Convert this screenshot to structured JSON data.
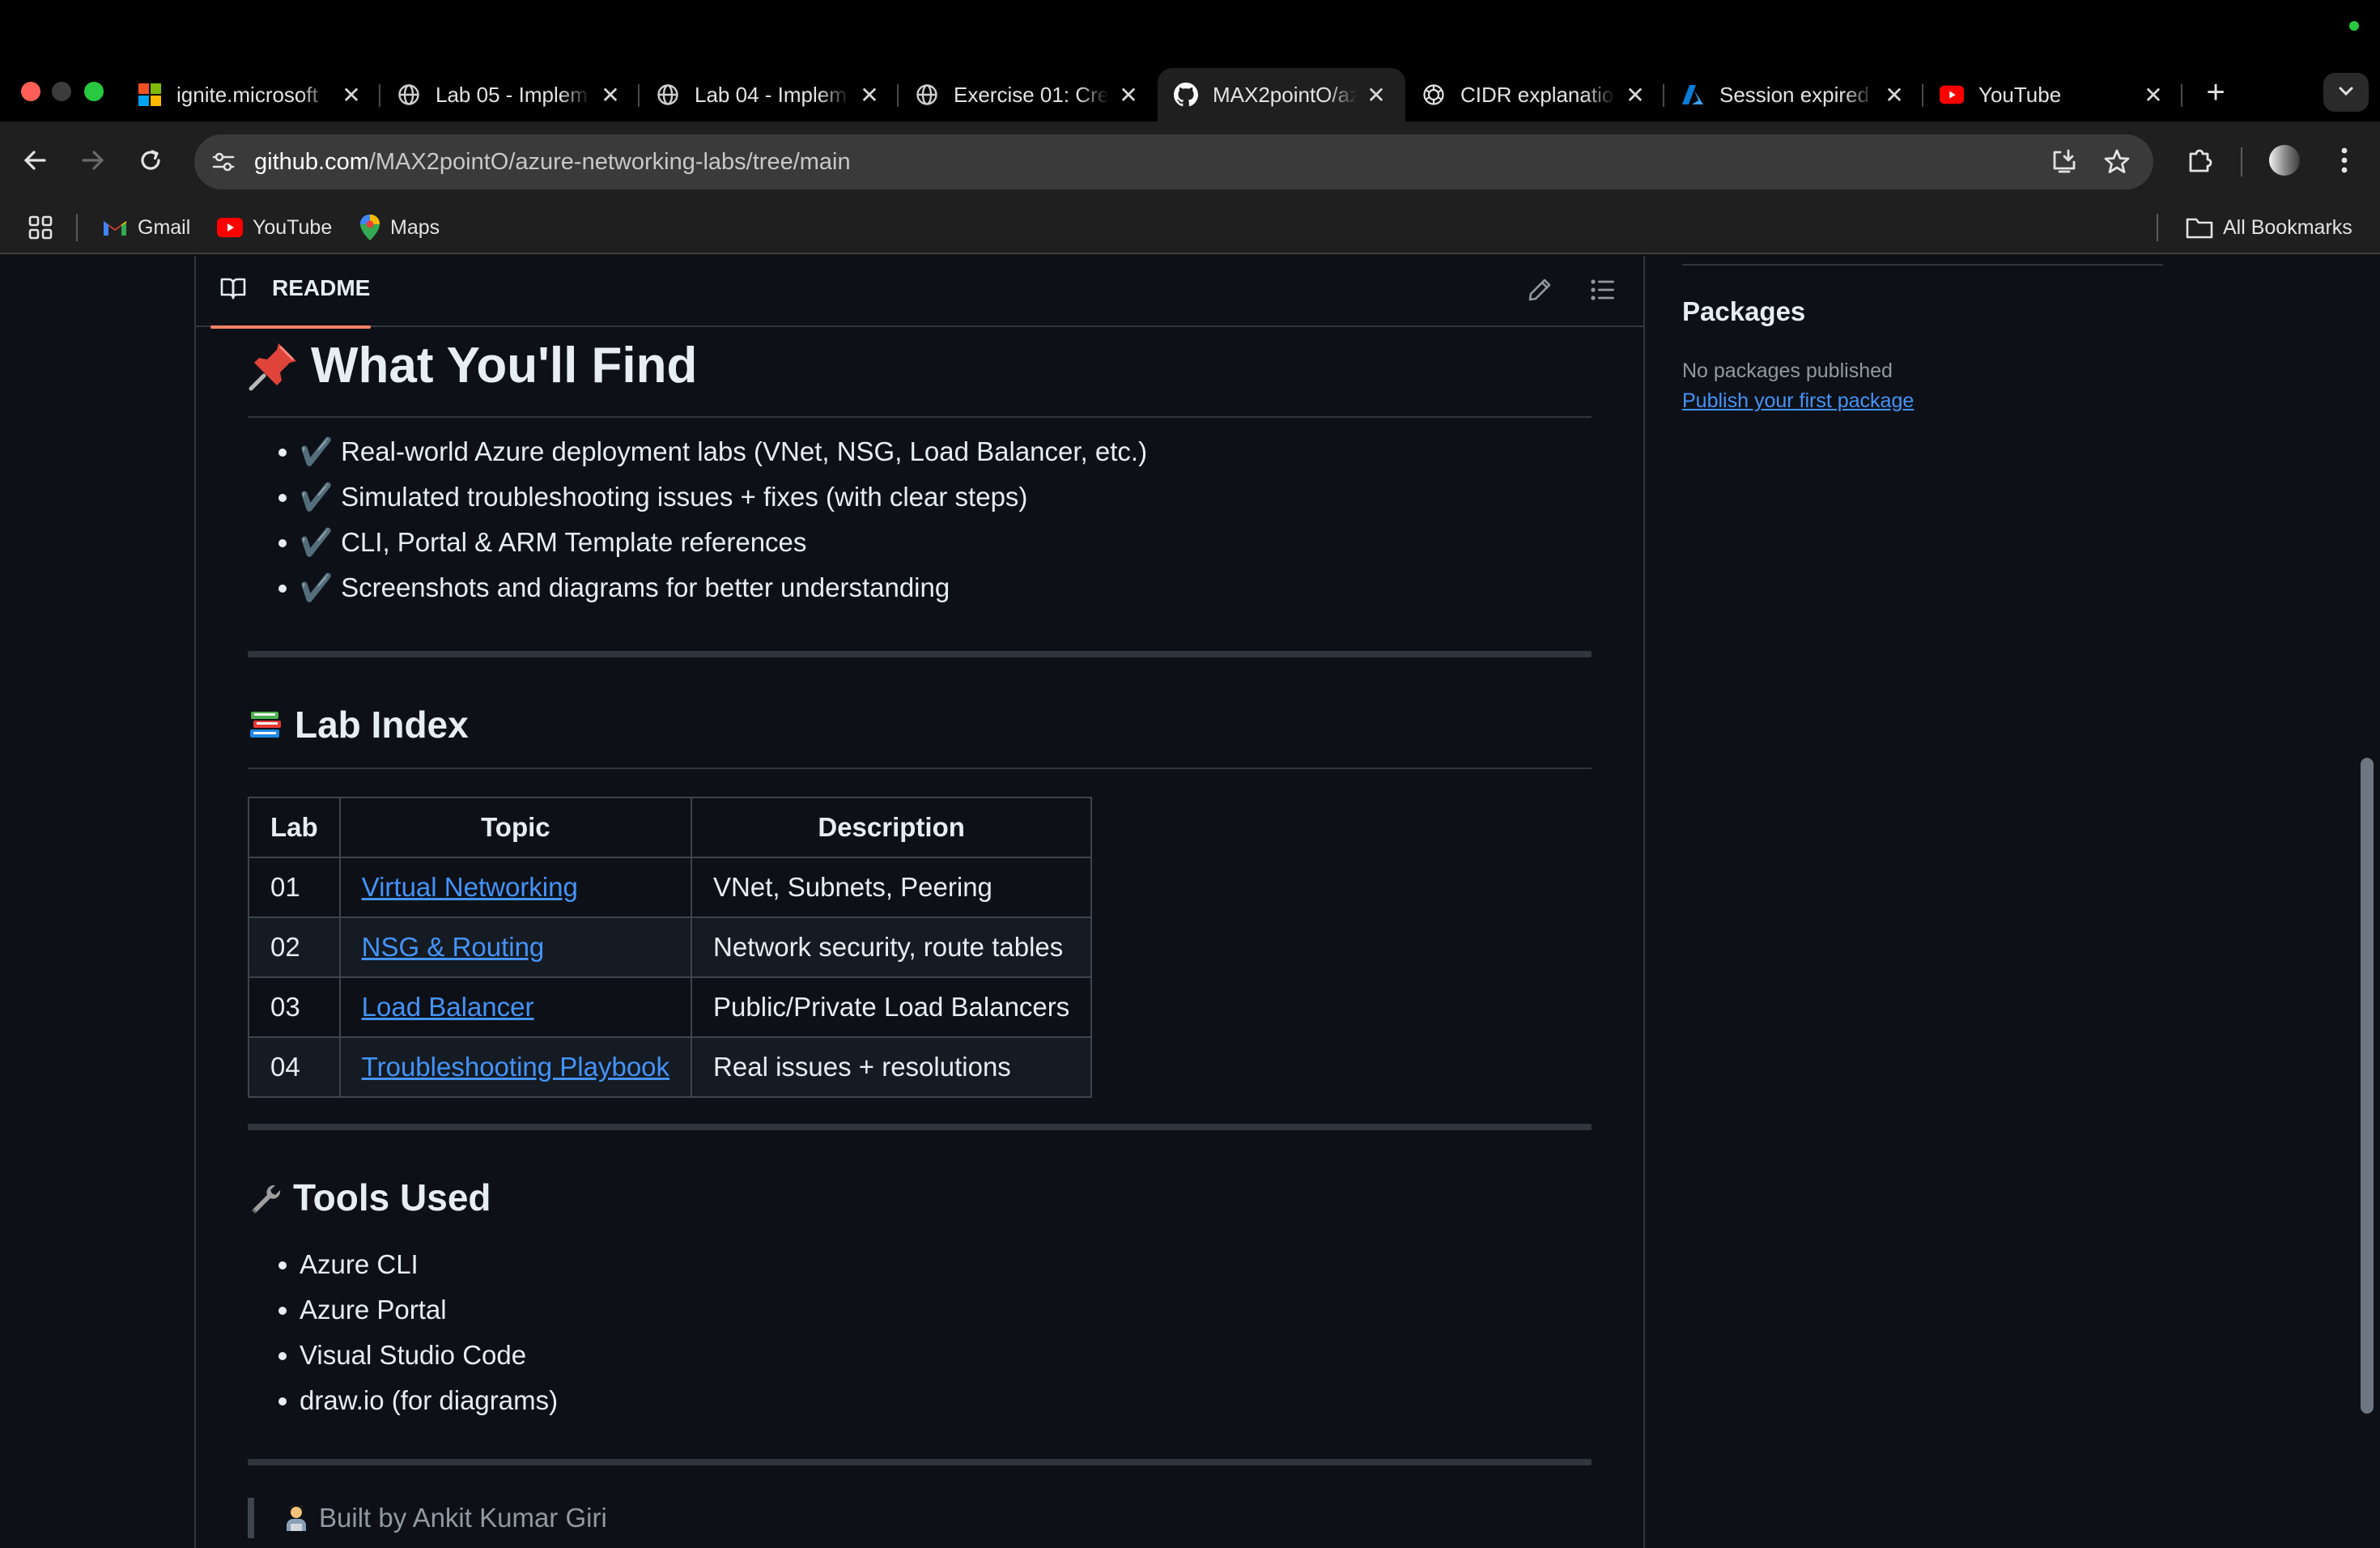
{
  "browser": {
    "tabs": [
      {
        "title": "ignite.microsoft",
        "icon": "microsoft-logo-icon"
      },
      {
        "title": "Lab 05 - Implem",
        "icon": "globe-icon"
      },
      {
        "title": "Lab 04 - Implem",
        "icon": "globe-icon"
      },
      {
        "title": "Exercise 01: Cre",
        "icon": "globe-icon"
      },
      {
        "title": "MAX2pointO/az",
        "icon": "github-icon",
        "active": true
      },
      {
        "title": "CIDR explanatio",
        "icon": "openai-icon"
      },
      {
        "title": "Session expired",
        "icon": "azure-icon"
      },
      {
        "title": "YouTube",
        "icon": "youtube-icon"
      }
    ],
    "close_glyph": "✕",
    "new_tab_glyph": "+",
    "url_host": "github.com",
    "url_path": "/MAX2pointO/azure-networking-labs/tree/main",
    "bookmarks": [
      {
        "label": "Gmail"
      },
      {
        "label": "YouTube"
      },
      {
        "label": "Maps"
      }
    ],
    "all_bookmarks": "All Bookmarks"
  },
  "readme": {
    "tab_label": "README",
    "find_heading": "What You'll Find",
    "find_items": [
      "Real-world Azure deployment labs (VNet, NSG, Load Balancer, etc.)",
      "Simulated troubleshooting issues + fixes (with clear steps)",
      "CLI, Portal & ARM Template references",
      "Screenshots and diagrams for better understanding"
    ],
    "check_glyph": "✔️",
    "lab_index_heading": "Lab Index",
    "table": {
      "headers": [
        "Lab",
        "Topic",
        "Description"
      ],
      "rows": [
        {
          "lab": "01",
          "topic": "Virtual Networking",
          "description": "VNet, Subnets, Peering"
        },
        {
          "lab": "02",
          "topic": "NSG & Routing",
          "description": "Network security, route tables"
        },
        {
          "lab": "03",
          "topic": "Load Balancer",
          "description": "Public/Private Load Balancers"
        },
        {
          "lab": "04",
          "topic": "Troubleshooting Playbook",
          "description": "Real issues + resolutions"
        }
      ]
    },
    "tools_heading": "Tools Used",
    "tools": [
      "Azure CLI",
      "Azure Portal",
      "Visual Studio Code",
      "draw.io (for diagrams)"
    ],
    "footer_quote": "Built by Ankit Kumar Giri"
  },
  "sidebar": {
    "packages_title": "Packages",
    "packages_empty": "No packages published",
    "publish_link": "Publish your first package"
  }
}
